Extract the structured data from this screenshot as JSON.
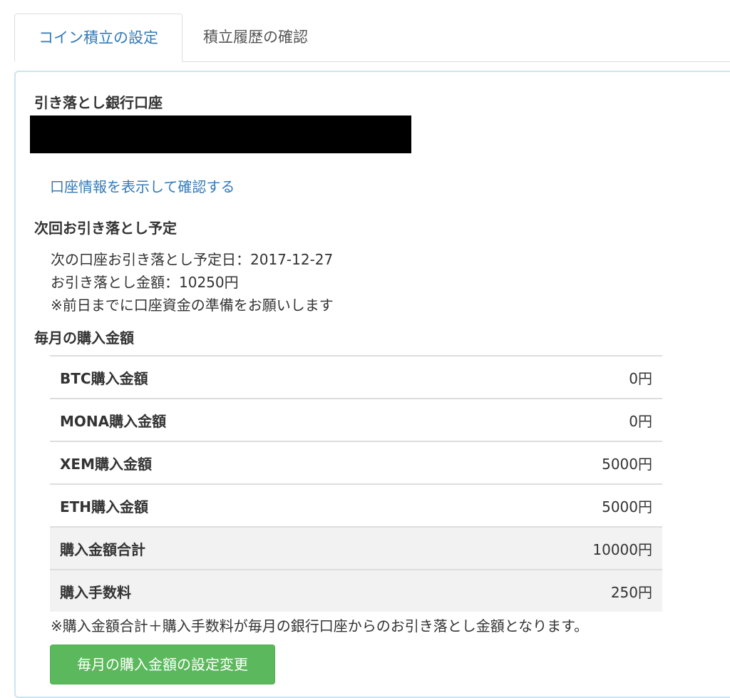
{
  "tabs": [
    {
      "label": "コイン積立の設定",
      "active": true
    },
    {
      "label": "積立履歴の確認",
      "active": false
    }
  ],
  "bank": {
    "heading": "引き落とし銀行口座",
    "show_account_link": "口座情報を表示して確認する"
  },
  "next_withdrawal": {
    "heading": "次回お引き落とし予定",
    "date_line": "次の口座お引き落とし予定日：2017-12-27",
    "amount_line": "お引き落とし金額：10250円",
    "notice": "※前日までに口座資金の準備をお願いします"
  },
  "monthly": {
    "heading": "毎月の購入金額",
    "rows": [
      {
        "label": "BTC購入金額",
        "value": "0円"
      },
      {
        "label": "MONA購入金額",
        "value": "0円"
      },
      {
        "label": "XEM購入金額",
        "value": "5000円"
      },
      {
        "label": "ETH購入金額",
        "value": "5000円"
      },
      {
        "label": "購入金額合計",
        "value": "10000円"
      },
      {
        "label": "購入手数料",
        "value": "250円"
      }
    ],
    "note": "※購入金額合計＋購入手数料が毎月の銀行口座からのお引き落とし金額となります。",
    "change_button": "毎月の購入金額の設定変更"
  },
  "colors": {
    "link": "#337ab7",
    "button": "#5cb85c",
    "panel_border": "#c9e6ef",
    "shaded_row": "#f2f2f2"
  }
}
